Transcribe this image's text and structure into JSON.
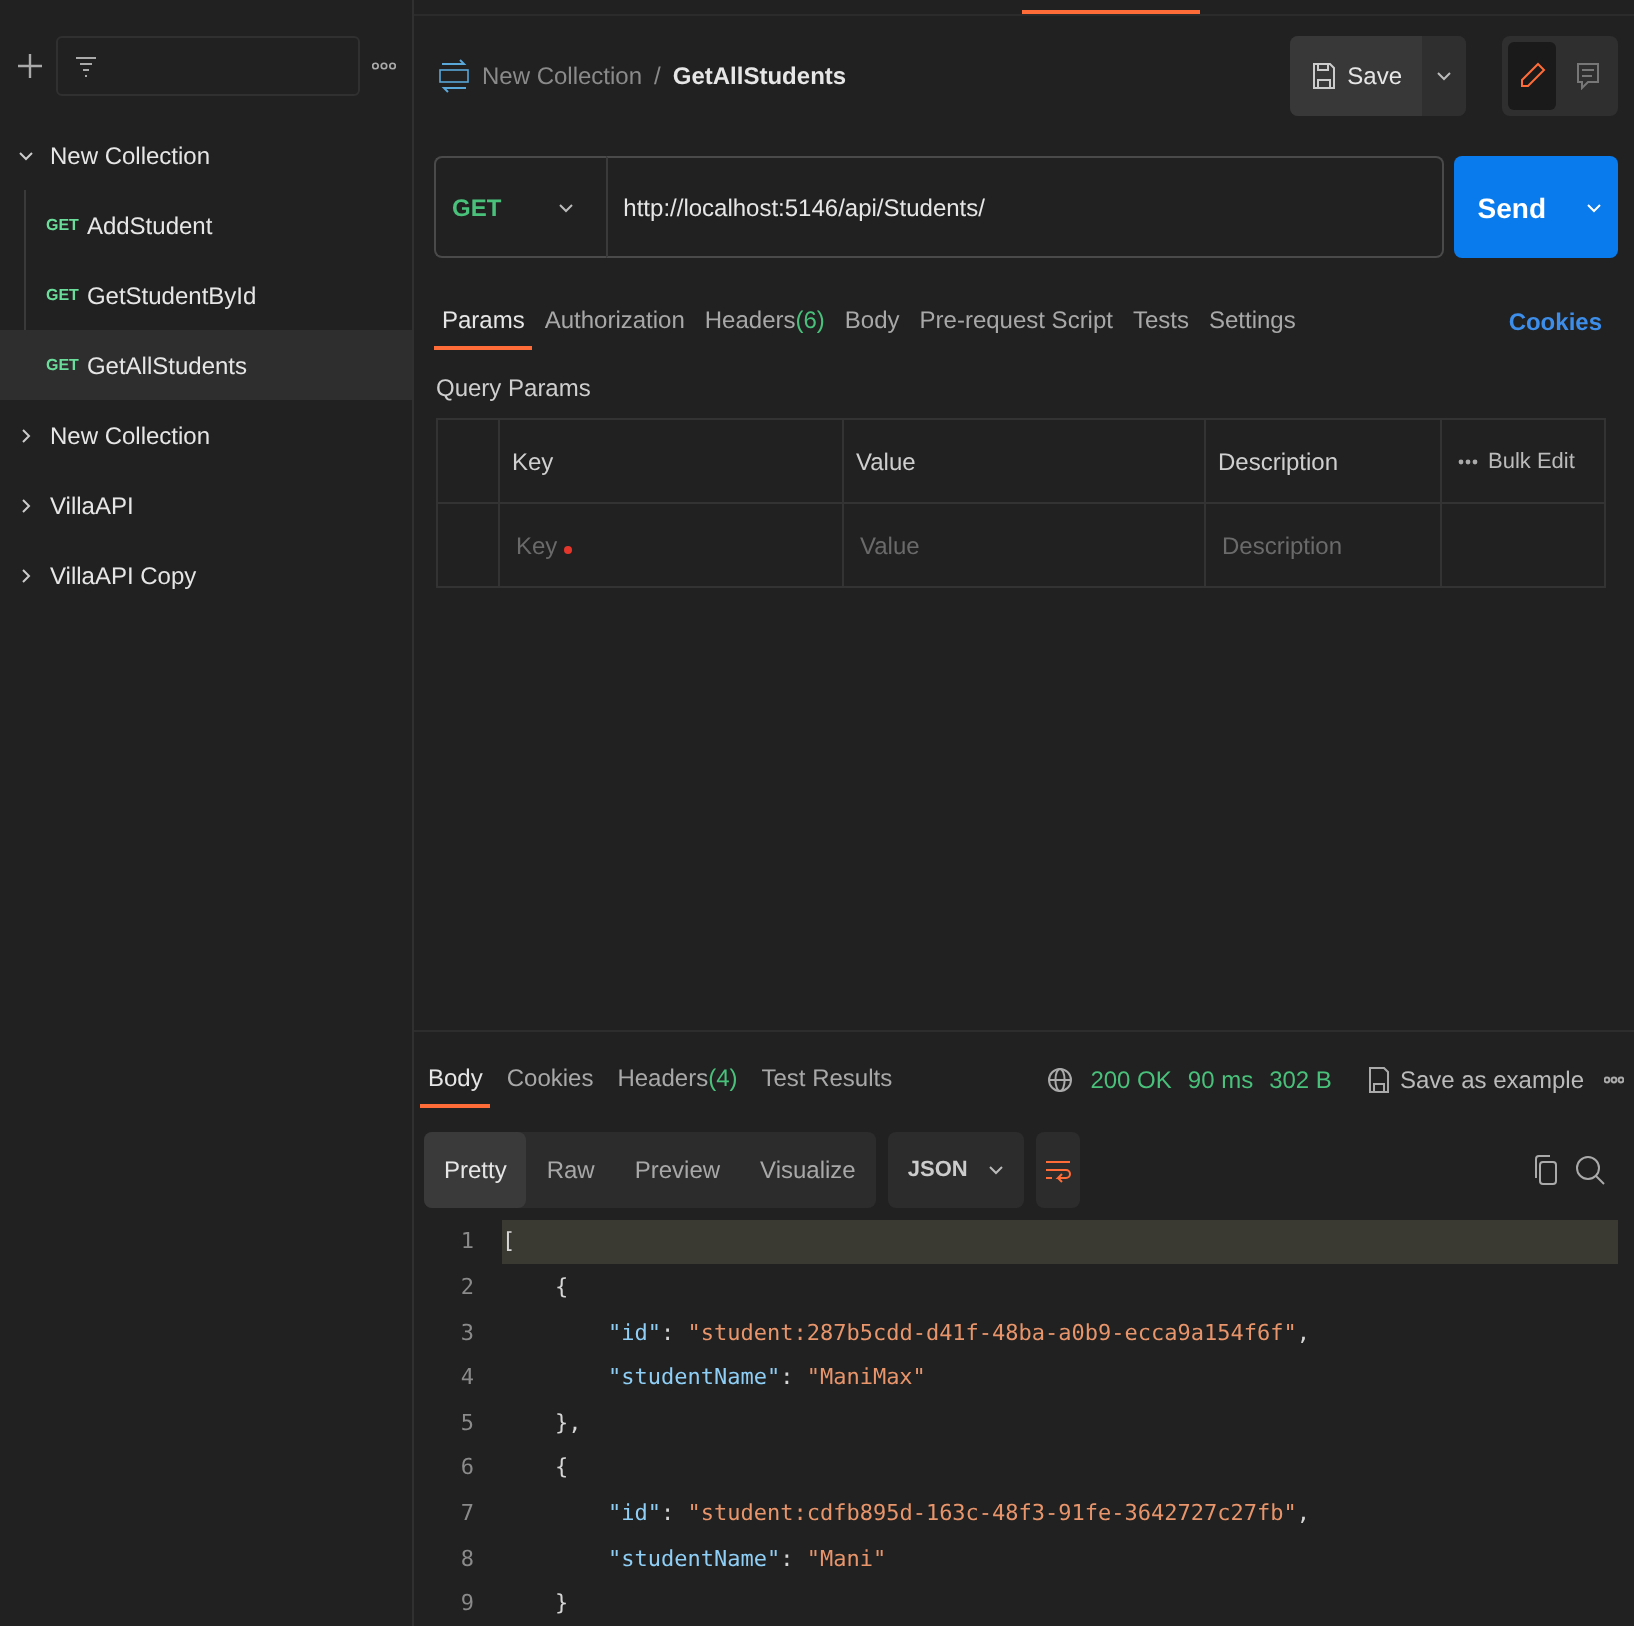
{
  "sidebar": {
    "tree": [
      {
        "name": "New Collection",
        "expanded": true,
        "children": [
          {
            "method": "GET",
            "name": "AddStudent",
            "selected": false
          },
          {
            "method": "GET",
            "name": "GetStudentById",
            "selected": false
          },
          {
            "method": "GET",
            "name": "GetAllStudents",
            "selected": true
          }
        ]
      },
      {
        "name": "New Collection",
        "expanded": false
      },
      {
        "name": "VillaAPI",
        "expanded": false
      },
      {
        "name": "VillaAPI Copy",
        "expanded": false
      }
    ]
  },
  "header": {
    "breadcrumb_parent": "New Collection",
    "separator": "/",
    "title": "GetAllStudents",
    "save_label": "Save"
  },
  "request": {
    "method": "GET",
    "url": "http://localhost:5146/api/Students/",
    "send_label": "Send"
  },
  "request_tabs": [
    {
      "label": "Params",
      "selected": true
    },
    {
      "label": "Authorization",
      "selected": false
    },
    {
      "label": "Headers",
      "count": "(6)",
      "selected": false
    },
    {
      "label": "Body",
      "selected": false
    },
    {
      "label": "Pre-request Script",
      "selected": false
    },
    {
      "label": "Tests",
      "selected": false
    },
    {
      "label": "Settings",
      "selected": false
    }
  ],
  "cookies_link": "Cookies",
  "query_params": {
    "title": "Query Params",
    "columns": [
      "Key",
      "Value",
      "Description"
    ],
    "bulk_edit": "Bulk Edit",
    "placeholders": [
      "Key",
      "Value",
      "Description"
    ]
  },
  "response_tabs": [
    {
      "label": "Body",
      "selected": true
    },
    {
      "label": "Cookies",
      "selected": false
    },
    {
      "label": "Headers",
      "count": "(4)",
      "selected": false
    },
    {
      "label": "Test Results",
      "selected": false
    }
  ],
  "response_status": {
    "status": "200 OK",
    "time": "90 ms",
    "size": "302 B",
    "save_example": "Save as example"
  },
  "view_modes": [
    {
      "label": "Pretty",
      "selected": true
    },
    {
      "label": "Raw",
      "selected": false
    },
    {
      "label": "Preview",
      "selected": false
    },
    {
      "label": "Visualize",
      "selected": false
    }
  ],
  "format": "JSON",
  "code_lines": [
    {
      "number": "1",
      "tokens": [
        {
          "kind": "punct",
          "text": "["
        }
      ]
    },
    {
      "number": "2",
      "tokens": [
        {
          "kind": "punct",
          "text": "    {"
        }
      ]
    },
    {
      "number": "3",
      "tokens": [
        {
          "kind": "key",
          "text": "        \"id\""
        },
        {
          "kind": "punct",
          "text": ": "
        },
        {
          "kind": "string",
          "text": "\"student:287b5cdd-d41f-48ba-a0b9-ecca9a154f6f\""
        },
        {
          "kind": "punct",
          "text": ","
        }
      ]
    },
    {
      "number": "4",
      "tokens": [
        {
          "kind": "key",
          "text": "        \"studentName\""
        },
        {
          "kind": "punct",
          "text": ": "
        },
        {
          "kind": "string",
          "text": "\"ManiMax\""
        }
      ]
    },
    {
      "number": "5",
      "tokens": [
        {
          "kind": "punct",
          "text": "    },"
        }
      ]
    },
    {
      "number": "6",
      "tokens": [
        {
          "kind": "punct",
          "text": "    {"
        }
      ]
    },
    {
      "number": "7",
      "tokens": [
        {
          "kind": "key",
          "text": "        \"id\""
        },
        {
          "kind": "punct",
          "text": ": "
        },
        {
          "kind": "string",
          "text": "\"student:cdfb895d-163c-48f3-91fe-3642727c27fb\""
        },
        {
          "kind": "punct",
          "text": ","
        }
      ]
    },
    {
      "number": "8",
      "tokens": [
        {
          "kind": "key",
          "text": "        \"studentName\""
        },
        {
          "kind": "punct",
          "text": ": "
        },
        {
          "kind": "string",
          "text": "\"Mani\""
        }
      ]
    },
    {
      "number": "9",
      "tokens": [
        {
          "kind": "punct",
          "text": "    }"
        }
      ]
    }
  ]
}
